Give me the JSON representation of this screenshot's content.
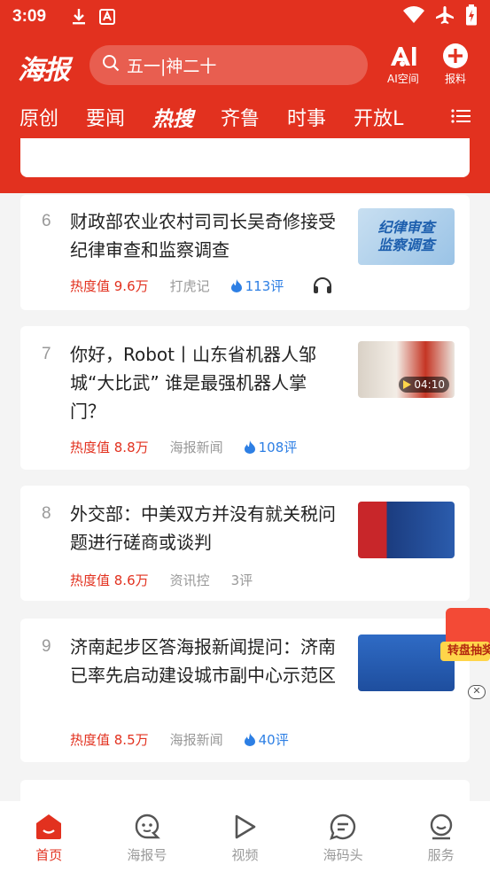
{
  "status_bar": {
    "time": "3:09"
  },
  "header": {
    "logo": "海报",
    "search_placeholder": "五一|神二十",
    "ai_label": "AI空间",
    "report_label": "报料"
  },
  "tabs": [
    {
      "label": "原创",
      "active": false
    },
    {
      "label": "要闻",
      "active": false
    },
    {
      "label": "热搜",
      "active": true
    },
    {
      "label": "齐鲁",
      "active": false
    },
    {
      "label": "时事",
      "active": false
    },
    {
      "label": "开放L",
      "active": false
    }
  ],
  "news": [
    {
      "rank": "6",
      "title": "财政部农业农村司司长吴奇修接受纪律审查和监察调查",
      "heat": "热度值 9.6万",
      "source": "打虎记",
      "comments": "113评",
      "has_audio": true,
      "thumb_text": [
        "纪律审查",
        "监察调查"
      ]
    },
    {
      "rank": "7",
      "title": "你好，Robot丨山东省机器人邹城“大比武” 谁是最强机器人掌门？",
      "heat": "热度值 8.8万",
      "source": "海报新闻",
      "comments": "108评",
      "video_duration": "04:10"
    },
    {
      "rank": "8",
      "title": "外交部：中美双方并没有就关税问题进行磋商或谈判",
      "heat": "热度值 8.6万",
      "source": "资讯控",
      "comments": "3评"
    },
    {
      "rank": "9",
      "title": "济南起步区答海报新闻提问：济南已率先启动建设城市副中心示范区",
      "heat": "热度值 8.5万",
      "source": "海报新闻",
      "comments": "40评"
    }
  ],
  "promo": {
    "label": "转盘抽奖",
    "close": "✕"
  },
  "bottom_nav": [
    {
      "label": "首页",
      "icon": "home-icon",
      "active": true
    },
    {
      "label": "海报号",
      "icon": "face-icon",
      "active": false
    },
    {
      "label": "视频",
      "icon": "play-icon",
      "active": false
    },
    {
      "label": "海码头",
      "icon": "chat-icon",
      "active": false
    },
    {
      "label": "服务",
      "icon": "service-icon",
      "active": false
    }
  ],
  "colors": {
    "brand": "#e2311f",
    "link": "#2d7fe4",
    "muted": "#999999"
  }
}
